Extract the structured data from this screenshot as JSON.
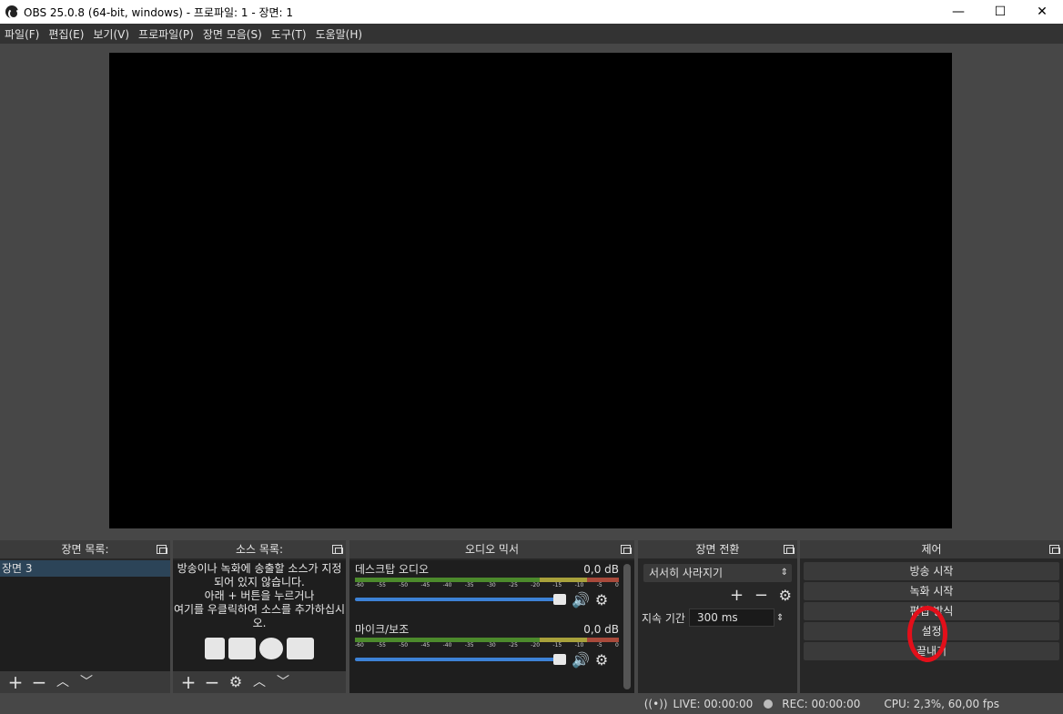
{
  "window": {
    "title": "OBS 25.0.8 (64-bit, windows) - 프로파일: 1 - 장면: 1",
    "minimize": "—",
    "maximize": "☐",
    "close": "✕"
  },
  "menu": [
    "파일(F)",
    "편집(E)",
    "보기(V)",
    "프로파일(P)",
    "장면 모음(S)",
    "도구(T)",
    "도움말(H)"
  ],
  "scenes": {
    "title": "장면 목록:",
    "items": [
      "장면 3"
    ]
  },
  "sources": {
    "title": "소스 목록:",
    "empty_message": "방송이나 녹화에 송출할 소스가 지정되어 있지 않습니다.\n아래 + 버튼을 누르거나\n여기를 우클릭하여 소스를 추가하십시오."
  },
  "mixer": {
    "title": "오디오 믹서",
    "channels": [
      {
        "name": "데스크탑 오디오",
        "level": "0,0 dB",
        "volume": 1.0
      },
      {
        "name": "마이크/보조",
        "level": "0,0 dB",
        "volume": 1.0
      }
    ],
    "ticks": [
      "-60",
      "-55",
      "-50",
      "-45",
      "-40",
      "-35",
      "-30",
      "-25",
      "-20",
      "-15",
      "-10",
      "-5",
      "0"
    ]
  },
  "transitions": {
    "title": "장면 전환",
    "selected": "서서히 사라지기",
    "duration_label": "지속 기간",
    "duration_value": "300 ms"
  },
  "controls": {
    "title": "제어",
    "buttons": [
      "방송 시작",
      "녹화 시작",
      "편집 방식",
      "설정",
      "끝내기"
    ]
  },
  "status": {
    "live": "LIVE: 00:00:00",
    "rec": "REC: 00:00:00",
    "cpu": "CPU: 2,3%, 60,00 fps"
  },
  "colors": {
    "annotation": "#e30f1a",
    "fader": "#3d82d6"
  }
}
